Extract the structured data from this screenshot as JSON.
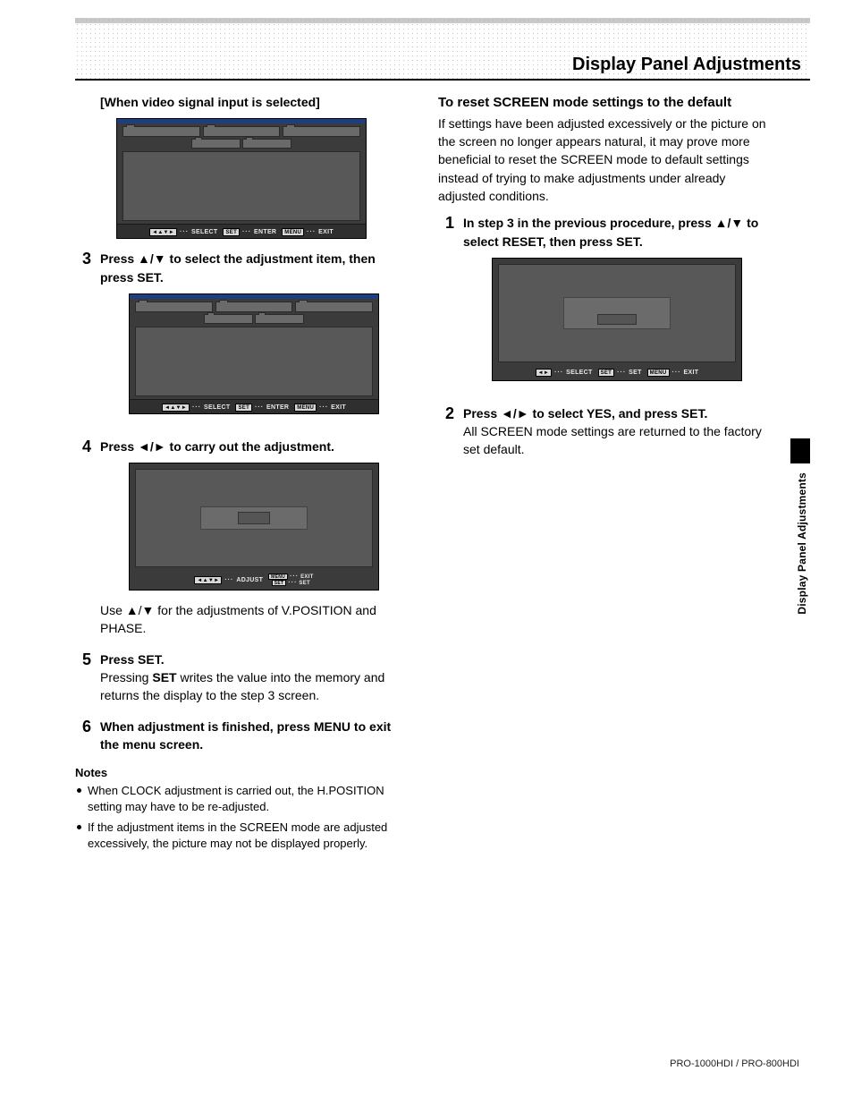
{
  "header": {
    "title": "Display Panel Adjustments"
  },
  "side_tab": {
    "label": "Display Panel Adjustments"
  },
  "footer": {
    "model": "PRO-1000HDI / PRO-800HDI"
  },
  "left": {
    "bracket_line": "[When video signal input is selected]",
    "s3": {
      "num": "3",
      "head": "Press ▲/▼ to select the adjustment item, then press SET."
    },
    "s4": {
      "num": "4",
      "head": "Press ◄/► to carry out the adjustment.",
      "note": "Use ▲/▼ for the adjustments of V.POSITION and PHASE."
    },
    "s5": {
      "num": "5",
      "head": "Press SET.",
      "body_a": "Pressing ",
      "body_set": "SET",
      "body_b": " writes the value into the memory and returns the display to the step 3 screen."
    },
    "s6": {
      "num": "6",
      "head": "When adjustment is finished, press MENU to exit the menu screen."
    },
    "notes": {
      "title": "Notes",
      "items": [
        "When CLOCK adjustment is carried out, the H.POSITION setting may have to be re-adjusted.",
        "If the adjustment items in the SCREEN mode are adjusted excessively, the picture may not be displayed properly."
      ]
    }
  },
  "right": {
    "title": "To reset SCREEN mode settings to the default",
    "intro": "If settings have been adjusted excessively or the picture on the screen no longer appears natural, it may prove more beneficial to reset the SCREEN mode to default settings instead of trying to make adjustments under already adjusted conditions.",
    "s1": {
      "num": "1",
      "head": "In step 3 in the previous procedure, press ▲/▼ to select RESET, then press SET."
    },
    "s2": {
      "num": "2",
      "head": "Press ◄/► to select YES, and press SET.",
      "body": "All SCREEN mode settings are returned to the factory set default."
    }
  },
  "osd": {
    "hint_select_full": {
      "arrows_key": "◄▲▼►",
      "dots": "···",
      "label": "SELECT",
      "set_key": "SET",
      "set_label": "ENTER",
      "menu_key": "MENU",
      "menu_label": "EXIT"
    },
    "hint_adjust": {
      "arrows_key": "◄▲▼►",
      "dots": "···",
      "label": "ADJUST",
      "menu_key": "MENU",
      "menu_label": "EXIT",
      "set_key": "SET",
      "set_label": "SET"
    },
    "hint_reset": {
      "arrows_key": "◄►",
      "dots": "···",
      "label": "SELECT",
      "set_key": "SET",
      "set_label": "SET",
      "menu_key": "MENU",
      "menu_label": "EXIT"
    }
  }
}
